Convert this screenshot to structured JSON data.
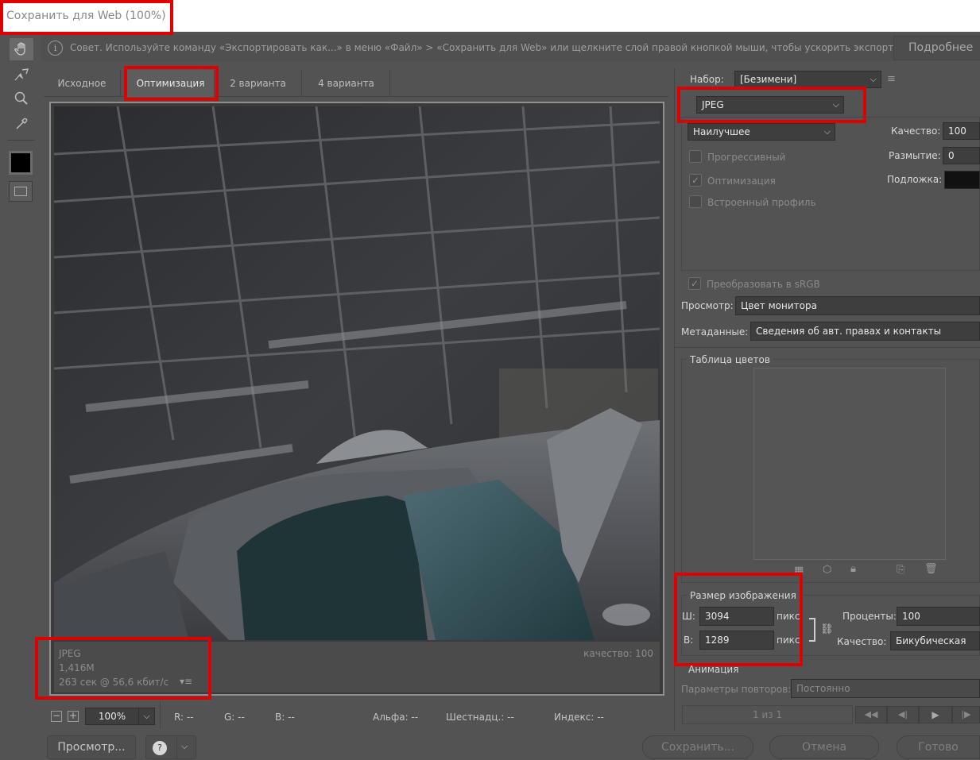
{
  "window": {
    "title": "Сохранить для Web (100%)"
  },
  "tip": {
    "text": "Совет. Используйте команду «Экспортировать как...» в меню «Файл» > «Сохранить для Web» или щелкните слой правой кнопкой мыши, чтобы ускорить экспорт ресурсов",
    "more_label": "Подробнее",
    "icon": "info-icon"
  },
  "tools": [
    "hand-icon",
    "slice-select-icon",
    "zoom-icon",
    "eyedropper-icon",
    "color-swatch",
    "slice-visibility-icon"
  ],
  "tabs": [
    {
      "label": "Исходное"
    },
    {
      "label": "Оптимизация"
    },
    {
      "label": "2 варианта"
    },
    {
      "label": "4 варианта"
    }
  ],
  "preview": {
    "format": "JPEG",
    "size": "1,416M",
    "time": "263 сек @ 56,6 кбит/с",
    "quality": "качество: 100"
  },
  "zoom": {
    "value": "100%"
  },
  "channels": {
    "r": "R: --",
    "g": "G: --",
    "b": "B: --",
    "alpha": "Альфа: --",
    "hex": "Шестнадц.: --",
    "index": "Индекс: --"
  },
  "settings": {
    "preset_label": "Набор:",
    "preset_value": "[Безимени]",
    "format_value": "JPEG",
    "quality_preset": "Наилучшее",
    "quality_label": "Качество:",
    "quality_value": "100",
    "blur_label": "Размытие:",
    "blur_value": "0",
    "matte_label": "Подложка:",
    "matte_color": "#111111",
    "progressive_label": "Прогрессивный",
    "optimized_label": "Оптимизация",
    "embed_profile_label": "Встроенный профиль",
    "convert_srgb_label": "Преобразовать в sRGB",
    "preview_label": "Просмотр:",
    "preview_value": "Цвет монитора",
    "metadata_label": "Метаданные:",
    "metadata_value": "Сведения об авт. правах и контакты"
  },
  "color_table": {
    "title": "Таблица цветов"
  },
  "image_size": {
    "title": "Размер изображения",
    "w_label": "Ш:",
    "w_value": "3094",
    "h_label": "В:",
    "h_value": "1289",
    "unit": "пикс.",
    "percent_label": "Проценты:",
    "percent_value": "100",
    "quality_label": "Качество:",
    "quality_value": "Бикубическая"
  },
  "animation": {
    "title": "Анимация",
    "loop_label": "Параметры повторов:",
    "loop_value": "Постоянно",
    "frame_counter": "1 из 1"
  },
  "footer": {
    "preview_button": "Просмотр...",
    "save_button": "Сохранить...",
    "cancel_button": "Отмена",
    "done_button": "Готово"
  },
  "highlight_color": "#e00000"
}
